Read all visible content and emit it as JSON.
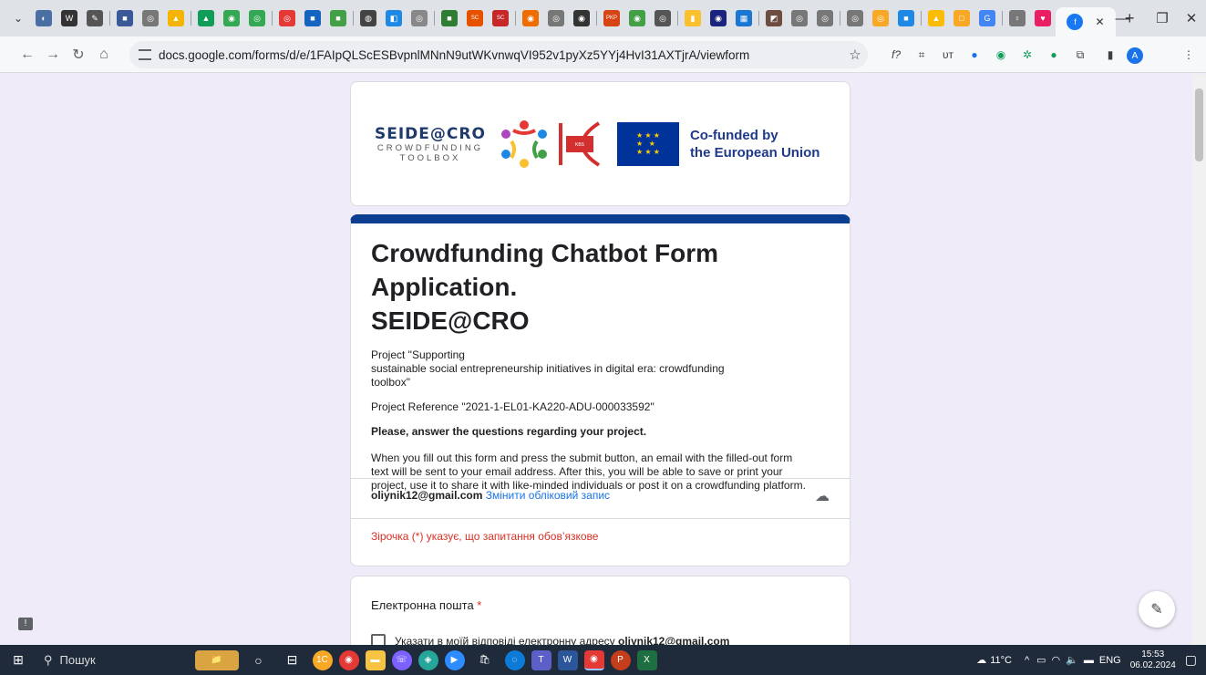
{
  "browser": {
    "url": "docs.google.com/forms/d/e/1FAIpQLScESBvpnlMNnN9utWKvnwqVI952v1pyXz5YYj4HvI31AXTjrA/viewform",
    "profile_initial": "A",
    "tab_icons": [
      {
        "color": "#4a6fa5",
        "glyph": "◐"
      },
      {
        "color": "#333",
        "glyph": "W"
      },
      {
        "color": "#555",
        "glyph": "✎"
      },
      {
        "color": "#3b5998",
        "glyph": "■"
      },
      {
        "color": "#777",
        "glyph": "◎"
      },
      {
        "color": "#f4b400",
        "glyph": "▲"
      },
      {
        "color": "#0f9d58",
        "glyph": "▲"
      },
      {
        "color": "#34a853",
        "glyph": "◉"
      },
      {
        "color": "#34a853",
        "glyph": "◎"
      },
      {
        "color": "#e53935",
        "glyph": "◎"
      },
      {
        "color": "#1565c0",
        "glyph": "■"
      },
      {
        "color": "#43a047",
        "glyph": "■"
      },
      {
        "color": "#444",
        "glyph": "◍"
      },
      {
        "color": "#1e88e5",
        "glyph": "◧"
      },
      {
        "color": "#888",
        "glyph": "◎"
      },
      {
        "color": "#2e7d32",
        "glyph": "■"
      },
      {
        "color": "#e65100",
        "glyph": "SC"
      },
      {
        "color": "#c62828",
        "glyph": "SC"
      },
      {
        "color": "#ef6c00",
        "glyph": "◉"
      },
      {
        "color": "#777",
        "glyph": "◎"
      },
      {
        "color": "#333",
        "glyph": "◉"
      },
      {
        "color": "#d84315",
        "glyph": "PKP"
      },
      {
        "color": "#43a047",
        "glyph": "◉"
      },
      {
        "color": "#555",
        "glyph": "◎"
      },
      {
        "color": "#fbc02d",
        "glyph": "▮"
      },
      {
        "color": "#1a237e",
        "glyph": "◉"
      },
      {
        "color": "#1976d2",
        "glyph": "▦"
      },
      {
        "color": "#6d4c41",
        "glyph": "◩"
      },
      {
        "color": "#777",
        "glyph": "◎"
      },
      {
        "color": "#777",
        "glyph": "◎"
      },
      {
        "color": "#777",
        "glyph": "◎"
      },
      {
        "color": "#f9a825",
        "glyph": "◎"
      },
      {
        "color": "#1e88e5",
        "glyph": "■"
      },
      {
        "color": "#fbbc04",
        "glyph": "▲"
      },
      {
        "color": "#f9a825",
        "glyph": "□"
      },
      {
        "color": "#4285f4",
        "glyph": "G"
      },
      {
        "color": "#777",
        "glyph": "♀"
      },
      {
        "color": "#e91e63",
        "glyph": "♥"
      }
    ],
    "active_tab_icon": "f",
    "new_tab_glyph": "+",
    "window": {
      "minimize": "—",
      "maximize": "❐",
      "close": "✕"
    }
  },
  "header": {
    "logo_title": "SEIDE@CRO",
    "logo_sub1": "CROWDFUNDING",
    "logo_sub2": "TOOLBOX",
    "school_logo_text": "KYIV BUSINESS SCHOOL",
    "eu_line1": "Co-funded by",
    "eu_line2": "the European Union"
  },
  "form": {
    "title_line1": "Crowdfunding Chatbot Form Application.",
    "title_line2": "SEIDE@CRO",
    "project_line1": "Project \"Supporting",
    "project_line2": "sustainable social entrepreneurship initiatives in digital era: crowdfunding",
    "project_line3": "toolbox\"",
    "reference": "Project Reference \"2021-1-EL01-KA220-ADU-000033592\"",
    "instruction": "Please, answer the questions regarding your project.",
    "info_line1": "When you fill out this form and press the submit button, an email with the filled-out form",
    "info_line2": "text will be sent to your email address. After this, you will be able to save or print your",
    "info_line3": "project, use it to share it with like-minded individuals or post it on a crowdfunding platform.",
    "account_email": "oliynik12@gmail.com",
    "switch_account": "Змінити обліковий запис",
    "required_note": "Зірочка (*) указує, що запитання обов’язкове"
  },
  "question": {
    "label": "Електронна пошта",
    "required_mark": "*",
    "checkbox_label": "Указати в моїй відповіді електронну адресу",
    "checkbox_email": "oliynik12@gmail.com"
  },
  "taskbar": {
    "search_label": "Пошук",
    "weather": "11°C",
    "lang": "ENG",
    "time": "15:53",
    "date": "06.02.2024"
  }
}
